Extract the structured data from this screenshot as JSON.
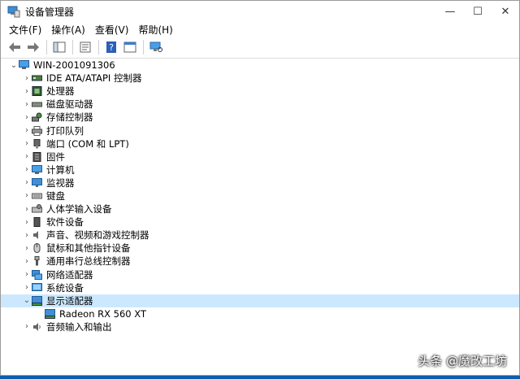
{
  "window": {
    "title": "设备管理器",
    "minimize": "—",
    "maximize": "☐",
    "close": "✕"
  },
  "menu": [
    "文件(F)",
    "操作(A)",
    "查看(V)",
    "帮助(H)"
  ],
  "tree": {
    "root": "WIN-2001091306",
    "items": [
      {
        "label": "IDE ATA/ATAPI 控制器",
        "icon": "ide-controller-icon",
        "expanded": false
      },
      {
        "label": "处理器",
        "icon": "processor-icon",
        "expanded": false
      },
      {
        "label": "磁盘驱动器",
        "icon": "disk-drive-icon",
        "expanded": false
      },
      {
        "label": "存储控制器",
        "icon": "storage-controller-icon",
        "expanded": false
      },
      {
        "label": "打印队列",
        "icon": "printer-icon",
        "expanded": false
      },
      {
        "label": "端口 (COM 和 LPT)",
        "icon": "port-icon",
        "expanded": false
      },
      {
        "label": "固件",
        "icon": "firmware-icon",
        "expanded": false
      },
      {
        "label": "计算机",
        "icon": "computer-icon",
        "expanded": false
      },
      {
        "label": "监视器",
        "icon": "monitor-icon",
        "expanded": false
      },
      {
        "label": "键盘",
        "icon": "keyboard-icon",
        "expanded": false
      },
      {
        "label": "人体学输入设备",
        "icon": "hid-icon",
        "expanded": false
      },
      {
        "label": "软件设备",
        "icon": "software-device-icon",
        "expanded": false
      },
      {
        "label": "声音、视频和游戏控制器",
        "icon": "sound-icon",
        "expanded": false
      },
      {
        "label": "鼠标和其他指针设备",
        "icon": "mouse-icon",
        "expanded": false
      },
      {
        "label": "通用串行总线控制器",
        "icon": "usb-icon",
        "expanded": false
      },
      {
        "label": "网络适配器",
        "icon": "network-adapter-icon",
        "expanded": false
      },
      {
        "label": "系统设备",
        "icon": "system-device-icon",
        "expanded": false
      },
      {
        "label": "显示适配器",
        "icon": "display-adapter-icon",
        "expanded": true,
        "selected": true
      }
    ],
    "child": {
      "label": "Radeon RX 560 XT",
      "icon": "display-adapter-icon"
    },
    "last": {
      "label": "音频输入和输出",
      "icon": "audio-io-icon",
      "expanded": false
    }
  },
  "watermark": "头条 @魔改工坊",
  "colors": {
    "selection": "#cce8ff",
    "desktop": "#1a73c8"
  }
}
